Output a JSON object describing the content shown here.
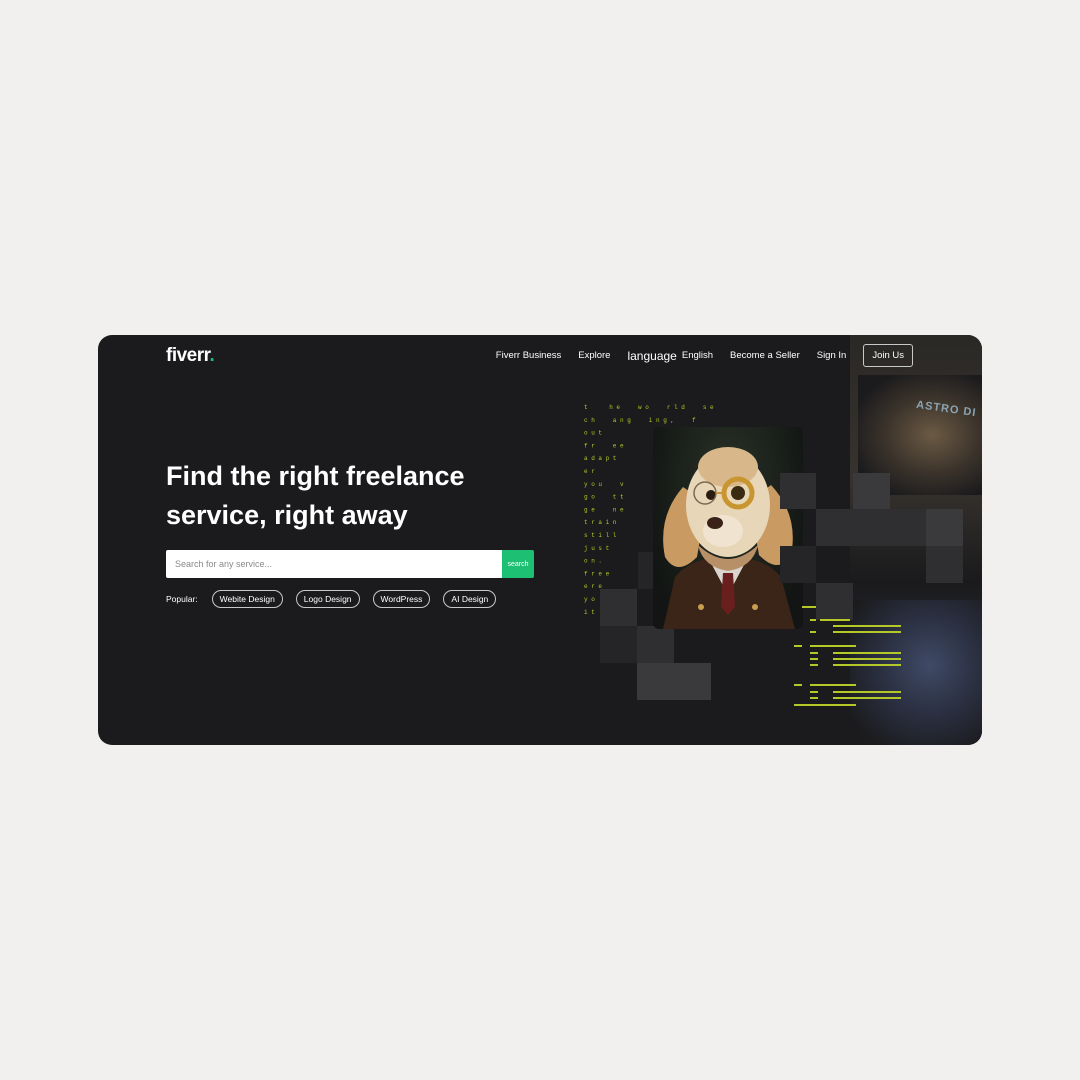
{
  "logo": {
    "text": "fiverr",
    "dot": "."
  },
  "nav": {
    "items": [
      "Fiverr Business",
      "Explore"
    ],
    "language_icon": "language",
    "language_label": "English",
    "become_seller": "Become a Seller",
    "sign_in": "Sign In",
    "join": "Join Us"
  },
  "hero": {
    "title": "Find the right freelance service, right away"
  },
  "search": {
    "placeholder": "Search for any service...",
    "button": "search"
  },
  "popular": {
    "label": "Popular:",
    "tags": [
      "Webite Design",
      "Logo Design",
      "WordPress",
      "AI Design"
    ]
  },
  "art": {
    "banner_text": "ASTRO DI",
    "matrix_lines": [
      "t      h e     w o     r l d     s e",
      "c h     a n g     i n g ,     f",
      "o u t",
      "f r     e e",
      "a d a p t",
      "e r",
      "y o u     v",
      "g o     t t",
      "g e     n e",
      "t r a i n",
      "s t i l l",
      "j u s t",
      "o n .",
      "f r e e",
      "e r e",
      "y o",
      "i t"
    ]
  },
  "colors": {
    "brand_green": "#1dbf73",
    "card_bg": "#1b1b1d",
    "page_bg": "#f1f0ee",
    "matrix_green": "#b4c828"
  }
}
